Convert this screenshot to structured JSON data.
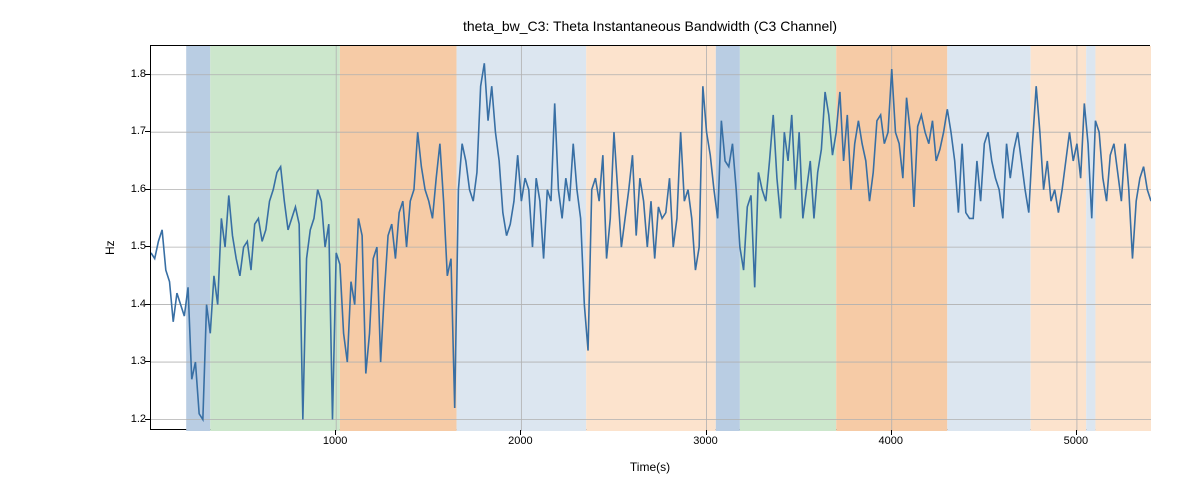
{
  "chart_data": {
    "type": "line",
    "title": "theta_bw_C3: Theta Instantaneous Bandwidth (C3 Channel)",
    "xlabel": "Time(s)",
    "ylabel": "Hz",
    "xlim": [
      0,
      5400
    ],
    "ylim": [
      1.18,
      1.85
    ],
    "xticks": [
      1000,
      2000,
      3000,
      4000,
      5000
    ],
    "yticks": [
      1.2,
      1.3,
      1.4,
      1.5,
      1.6,
      1.7,
      1.8
    ],
    "x": [
      0,
      20,
      40,
      60,
      80,
      100,
      120,
      140,
      160,
      180,
      200,
      220,
      240,
      260,
      280,
      300,
      320,
      340,
      360,
      380,
      400,
      420,
      440,
      460,
      480,
      500,
      520,
      540,
      560,
      580,
      600,
      620,
      640,
      660,
      680,
      700,
      720,
      740,
      760,
      780,
      800,
      820,
      840,
      860,
      880,
      900,
      920,
      940,
      960,
      980,
      1000,
      1020,
      1040,
      1060,
      1080,
      1100,
      1120,
      1140,
      1160,
      1180,
      1200,
      1220,
      1240,
      1260,
      1280,
      1300,
      1320,
      1340,
      1360,
      1380,
      1400,
      1420,
      1440,
      1460,
      1480,
      1500,
      1520,
      1540,
      1560,
      1580,
      1600,
      1620,
      1640,
      1660,
      1680,
      1700,
      1720,
      1740,
      1760,
      1780,
      1800,
      1820,
      1840,
      1860,
      1880,
      1900,
      1920,
      1940,
      1960,
      1980,
      2000,
      2020,
      2040,
      2060,
      2080,
      2100,
      2120,
      2140,
      2160,
      2180,
      2200,
      2220,
      2240,
      2260,
      2280,
      2300,
      2320,
      2340,
      2360,
      2380,
      2400,
      2420,
      2440,
      2460,
      2480,
      2500,
      2520,
      2540,
      2560,
      2580,
      2600,
      2620,
      2640,
      2660,
      2680,
      2700,
      2720,
      2740,
      2760,
      2780,
      2800,
      2820,
      2840,
      2860,
      2880,
      2900,
      2920,
      2940,
      2960,
      2980,
      3000,
      3020,
      3040,
      3060,
      3080,
      3100,
      3120,
      3140,
      3160,
      3180,
      3200,
      3220,
      3240,
      3260,
      3280,
      3300,
      3320,
      3340,
      3360,
      3380,
      3400,
      3420,
      3440,
      3460,
      3480,
      3500,
      3520,
      3540,
      3560,
      3580,
      3600,
      3620,
      3640,
      3660,
      3680,
      3700,
      3720,
      3740,
      3760,
      3780,
      3800,
      3820,
      3840,
      3860,
      3880,
      3900,
      3920,
      3940,
      3960,
      3980,
      4000,
      4020,
      4040,
      4060,
      4080,
      4100,
      4120,
      4140,
      4160,
      4180,
      4200,
      4220,
      4240,
      4260,
      4280,
      4300,
      4320,
      4340,
      4360,
      4380,
      4400,
      4420,
      4440,
      4460,
      4480,
      4500,
      4520,
      4540,
      4560,
      4580,
      4600,
      4620,
      4640,
      4660,
      4680,
      4700,
      4720,
      4740,
      4760,
      4780,
      4800,
      4820,
      4840,
      4860,
      4880,
      4900,
      4920,
      4940,
      4960,
      4980,
      5000,
      5020,
      5040,
      5060,
      5080,
      5100,
      5120,
      5140,
      5160,
      5180,
      5200,
      5220,
      5240,
      5260,
      5280,
      5300,
      5320,
      5340,
      5360,
      5380,
      5400
    ],
    "y": [
      1.49,
      1.48,
      1.51,
      1.53,
      1.46,
      1.44,
      1.37,
      1.42,
      1.4,
      1.38,
      1.43,
      1.27,
      1.3,
      1.21,
      1.2,
      1.4,
      1.35,
      1.45,
      1.4,
      1.55,
      1.5,
      1.59,
      1.52,
      1.48,
      1.45,
      1.5,
      1.51,
      1.46,
      1.54,
      1.55,
      1.51,
      1.53,
      1.58,
      1.6,
      1.63,
      1.64,
      1.58,
      1.53,
      1.55,
      1.57,
      1.54,
      1.2,
      1.48,
      1.53,
      1.55,
      1.6,
      1.58,
      1.5,
      1.54,
      1.2,
      1.49,
      1.47,
      1.35,
      1.3,
      1.44,
      1.4,
      1.55,
      1.52,
      1.28,
      1.35,
      1.48,
      1.5,
      1.3,
      1.42,
      1.52,
      1.54,
      1.48,
      1.56,
      1.58,
      1.5,
      1.58,
      1.6,
      1.7,
      1.64,
      1.6,
      1.58,
      1.55,
      1.62,
      1.68,
      1.58,
      1.45,
      1.48,
      1.22,
      1.6,
      1.68,
      1.65,
      1.6,
      1.58,
      1.63,
      1.78,
      1.82,
      1.72,
      1.78,
      1.7,
      1.65,
      1.56,
      1.52,
      1.54,
      1.58,
      1.66,
      1.58,
      1.62,
      1.6,
      1.5,
      1.62,
      1.58,
      1.48,
      1.6,
      1.58,
      1.75,
      1.6,
      1.55,
      1.62,
      1.58,
      1.68,
      1.6,
      1.55,
      1.4,
      1.32,
      1.6,
      1.62,
      1.58,
      1.66,
      1.48,
      1.55,
      1.7,
      1.6,
      1.5,
      1.55,
      1.6,
      1.66,
      1.52,
      1.62,
      1.58,
      1.5,
      1.58,
      1.48,
      1.57,
      1.55,
      1.56,
      1.62,
      1.5,
      1.55,
      1.7,
      1.58,
      1.6,
      1.55,
      1.46,
      1.5,
      1.78,
      1.7,
      1.66,
      1.6,
      1.55,
      1.72,
      1.65,
      1.64,
      1.68,
      1.6,
      1.5,
      1.46,
      1.57,
      1.59,
      1.43,
      1.63,
      1.6,
      1.58,
      1.65,
      1.73,
      1.62,
      1.55,
      1.7,
      1.65,
      1.73,
      1.6,
      1.7,
      1.55,
      1.6,
      1.65,
      1.55,
      1.63,
      1.67,
      1.77,
      1.73,
      1.66,
      1.7,
      1.77,
      1.65,
      1.73,
      1.6,
      1.68,
      1.72,
      1.68,
      1.65,
      1.58,
      1.63,
      1.72,
      1.73,
      1.68,
      1.7,
      1.81,
      1.7,
      1.68,
      1.62,
      1.76,
      1.7,
      1.57,
      1.71,
      1.73,
      1.7,
      1.68,
      1.72,
      1.65,
      1.67,
      1.7,
      1.74,
      1.7,
      1.65,
      1.56,
      1.68,
      1.56,
      1.55,
      1.55,
      1.65,
      1.58,
      1.68,
      1.7,
      1.65,
      1.62,
      1.6,
      1.55,
      1.68,
      1.62,
      1.67,
      1.7,
      1.65,
      1.6,
      1.56,
      1.68,
      1.78,
      1.7,
      1.6,
      1.65,
      1.58,
      1.6,
      1.56,
      1.6,
      1.65,
      1.7,
      1.65,
      1.68,
      1.62,
      1.75,
      1.68,
      1.55,
      1.72,
      1.7,
      1.62,
      1.58,
      1.66,
      1.68,
      1.63,
      1.58,
      1.68,
      1.6,
      1.48,
      1.58,
      1.62,
      1.64,
      1.6,
      1.58
    ],
    "background_regions": [
      {
        "start": 190,
        "end": 320,
        "color": "#b9cde3"
      },
      {
        "start": 320,
        "end": 1020,
        "color": "#cce7cc"
      },
      {
        "start": 1020,
        "end": 1650,
        "color": "#f6cba6"
      },
      {
        "start": 1650,
        "end": 2350,
        "color": "#dce6f0"
      },
      {
        "start": 2350,
        "end": 3050,
        "color": "#fce3cd"
      },
      {
        "start": 3050,
        "end": 3180,
        "color": "#b9cde3"
      },
      {
        "start": 3180,
        "end": 3700,
        "color": "#cce7cc"
      },
      {
        "start": 3700,
        "end": 4300,
        "color": "#f6cba6"
      },
      {
        "start": 4300,
        "end": 4750,
        "color": "#dce6f0"
      },
      {
        "start": 4750,
        "end": 5050,
        "color": "#fce3cd"
      },
      {
        "start": 5050,
        "end": 5100,
        "color": "#dce6f0"
      },
      {
        "start": 5100,
        "end": 5400,
        "color": "#fce3cd"
      }
    ],
    "line_color": "#386fa4",
    "grid_color": "#b0b0b0"
  }
}
